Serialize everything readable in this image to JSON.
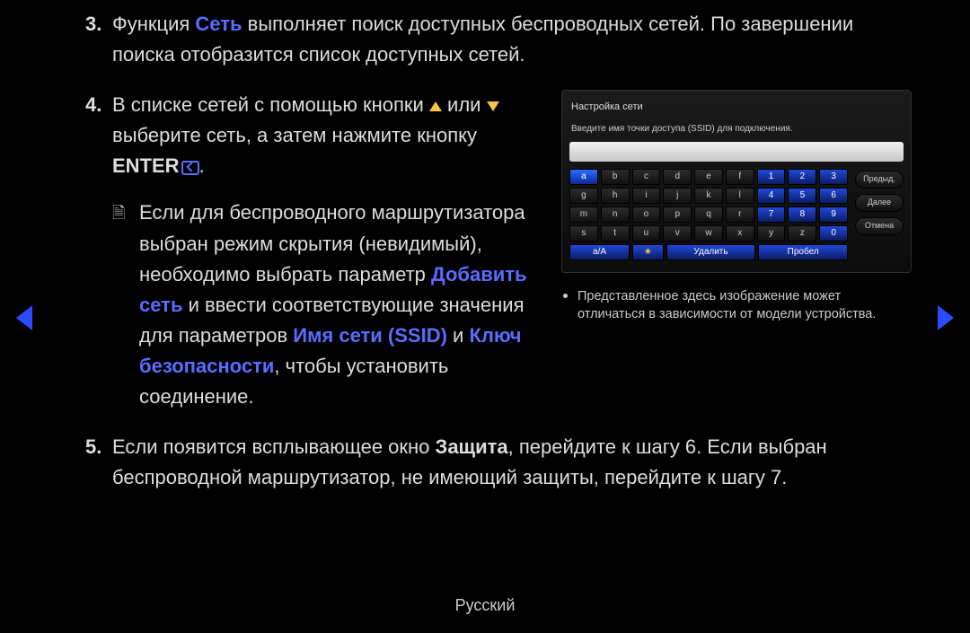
{
  "steps": {
    "s3": {
      "num": "3.",
      "t_before": "Функция ",
      "t_hl": "Сеть",
      "t_after": " выполняет поиск доступных беспроводных сетей. По завершении поиска отобразится список доступных сетей."
    },
    "s4": {
      "num": "4.",
      "line1a": "В списке сетей с помощью кнопки ",
      "line1b": " или ",
      "line1c": " выберите сеть, а затем нажмите кнопку ",
      "enter": "ENTER",
      "dot": ".",
      "note": {
        "p1": "Если для беспроводного маршрутизатора выбран режим скрытия (невидимый), необходимо выбрать параметр ",
        "h1": "Добавить сеть",
        "p2": " и ввести соответствующие значения для параметров ",
        "h2": "Имя сети (SSID)",
        "p3": " и ",
        "h3": "Ключ безопасности",
        "p4": ", чтобы установить соединение."
      }
    },
    "s5": {
      "num": "5.",
      "p1": "Если появится всплывающее окно ",
      "h1": "Защита",
      "p2": ", перейдите к шагу 6. Если выбран беспроводной маршрутизатор, не имеющий защиты, перейдите к шагу 7."
    }
  },
  "osk": {
    "title": "Настройка сети",
    "hint": "Введите имя точки доступа (SSID) для подключения.",
    "rows": [
      [
        "a",
        "b",
        "c",
        "d",
        "e",
        "f",
        "1",
        "2",
        "3"
      ],
      [
        "g",
        "h",
        "i",
        "j",
        "k",
        "l",
        "4",
        "5",
        "6"
      ],
      [
        "m",
        "n",
        "o",
        "p",
        "q",
        "r",
        "7",
        "8",
        "9"
      ],
      [
        "s",
        "t",
        "u",
        "v",
        "w",
        "x",
        "y",
        "z",
        "0"
      ]
    ],
    "bottom": {
      "case": "a/A",
      "star": "★",
      "del": "Удалить",
      "space": "Пробел"
    },
    "side": {
      "prev": "Предыд.",
      "next": "Далее",
      "cancel": "Отмена"
    }
  },
  "caption": "Представленное здесь изображение может отличаться в зависимости от модели устройства.",
  "footer": "Русский"
}
